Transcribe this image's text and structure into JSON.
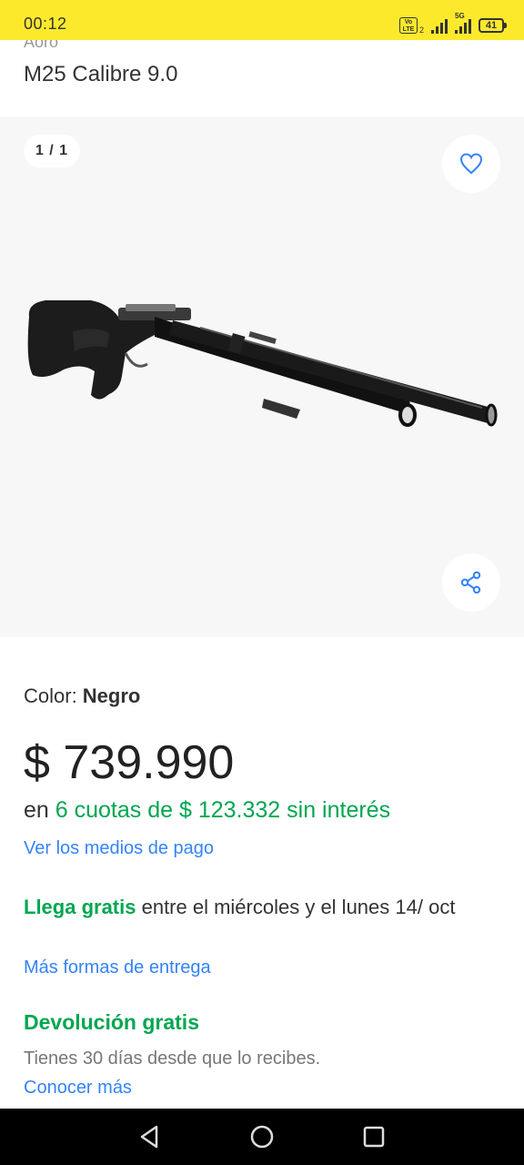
{
  "status_bar": {
    "time": "00:12",
    "network_badge_top": "Vo",
    "network_badge_bottom": "LTE",
    "network_sub": "2",
    "network_type": "5G",
    "battery": "41"
  },
  "product": {
    "title_above_cut": "Aoro",
    "title": "M25 Calibre 9.0"
  },
  "gallery": {
    "counter": "1 / 1",
    "favorite_icon": "heart-icon",
    "share_icon": "share-icon"
  },
  "variant": {
    "label": "Color: ",
    "value": "Negro"
  },
  "pricing": {
    "price": "$ 739.990",
    "installments_prefix": "en ",
    "installments_highlight": "6 cuotas de $ 123.332 sin interés",
    "payment_link": "Ver los medios de pago"
  },
  "shipping": {
    "highlight": "Llega gratis",
    "text": " entre el miércoles y el lunes 14/ oct",
    "more_link": "Más formas de entrega"
  },
  "returns": {
    "title": "Devolución gratis",
    "description": "Tienes 30 días desde que lo recibes.",
    "learn_link": "Conocer más"
  },
  "colors": {
    "status_bar_bg": "#fde92c",
    "link_blue": "#3483fa",
    "success_green": "#00a650"
  },
  "navbar": {
    "back_icon": "back-triangle-icon",
    "home_icon": "home-circle-icon",
    "recents_icon": "recents-square-icon"
  }
}
